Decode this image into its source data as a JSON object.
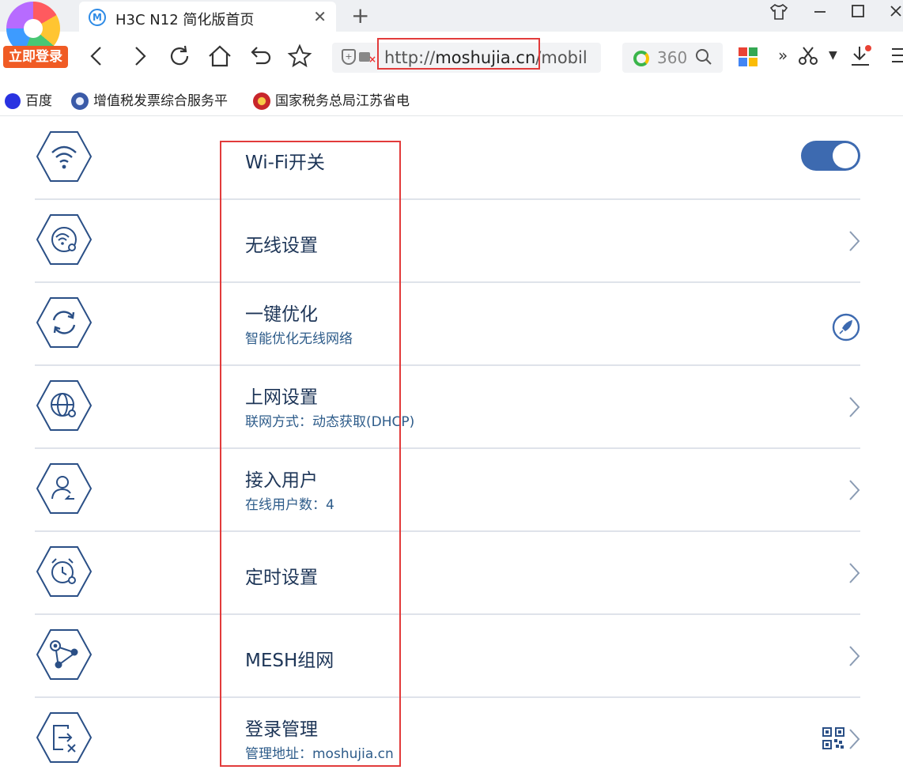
{
  "browser": {
    "tab": {
      "icon_letter": "M",
      "title": "H3C N12 简化版首页",
      "close": "✕"
    },
    "new_tab": "+",
    "login_badge": "立即登录",
    "address": {
      "scheme": "http://",
      "host": "moshujia.cn",
      "path": "/mobil"
    },
    "search": {
      "label": "360"
    },
    "bookmarks": [
      {
        "label": "百度",
        "icon": "baidu-paw-icon",
        "color": "#2932e1"
      },
      {
        "label": "增值税发票综合服务平",
        "icon": "globe-badge-icon",
        "color": "#3a5aa8"
      },
      {
        "label": "国家税务总局江苏省电",
        "icon": "tax-emblem-icon",
        "color": "#c8262b"
      }
    ]
  },
  "settings": {
    "accent_color": "#3d6ab0",
    "items": [
      {
        "id": "wifi",
        "title": "Wi-Fi开关",
        "subtitle": "",
        "icon": "wifi-icon",
        "control": "toggle",
        "toggle_on": true
      },
      {
        "id": "wireless",
        "title": "无线设置",
        "subtitle": "",
        "icon": "wifi-settings-icon",
        "control": "chevron"
      },
      {
        "id": "optimize",
        "title": "一键优化",
        "subtitle": "智能优化无线网络",
        "icon": "refresh-icon",
        "control": "rocket"
      },
      {
        "id": "internet",
        "title": "上网设置",
        "subtitle": "联网方式：动态获取(DHCP)",
        "icon": "globe-settings-icon",
        "control": "chevron"
      },
      {
        "id": "users",
        "title": "接入用户",
        "subtitle": "在线用户数：4",
        "icon": "user-icon",
        "control": "chevron"
      },
      {
        "id": "timer",
        "title": "定时设置",
        "subtitle": "",
        "icon": "alarm-clock-icon",
        "control": "chevron"
      },
      {
        "id": "mesh",
        "title": "MESH组网",
        "subtitle": "",
        "icon": "mesh-network-icon",
        "control": "chevron"
      },
      {
        "id": "login",
        "title": "登录管理",
        "subtitle": "管理地址：moshujia.cn",
        "icon": "login-manage-icon",
        "control": "qr-chevron"
      }
    ]
  }
}
